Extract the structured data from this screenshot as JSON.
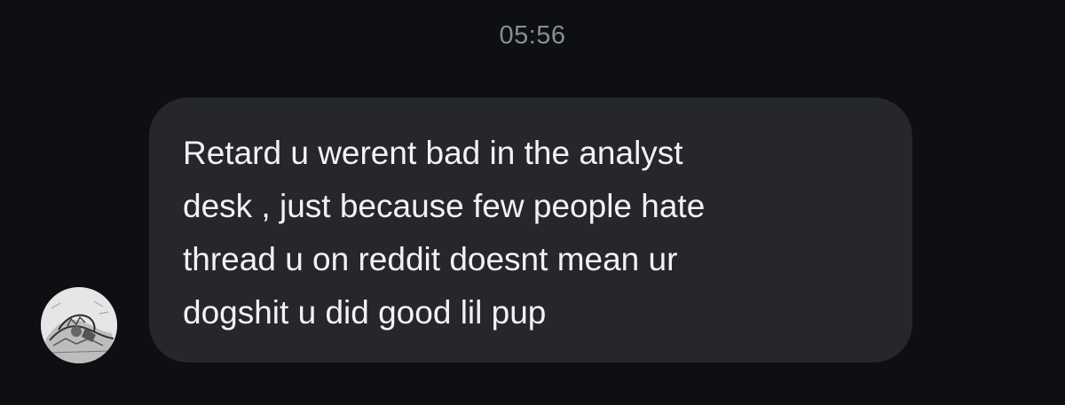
{
  "conversation": {
    "timestamp": "05:56",
    "message": {
      "text": "Retard u werent bad in the analyst\ndesk , just because few people hate\nthread u on reddit doesnt mean ur\ndogshit u did good lil pup"
    },
    "avatar": {
      "icon": "profile-picture-icon"
    }
  },
  "colors": {
    "background": "#0e0f13",
    "bubble": "#25272d",
    "text": "#f2f2f3",
    "timestamp": "#8a8c93"
  }
}
